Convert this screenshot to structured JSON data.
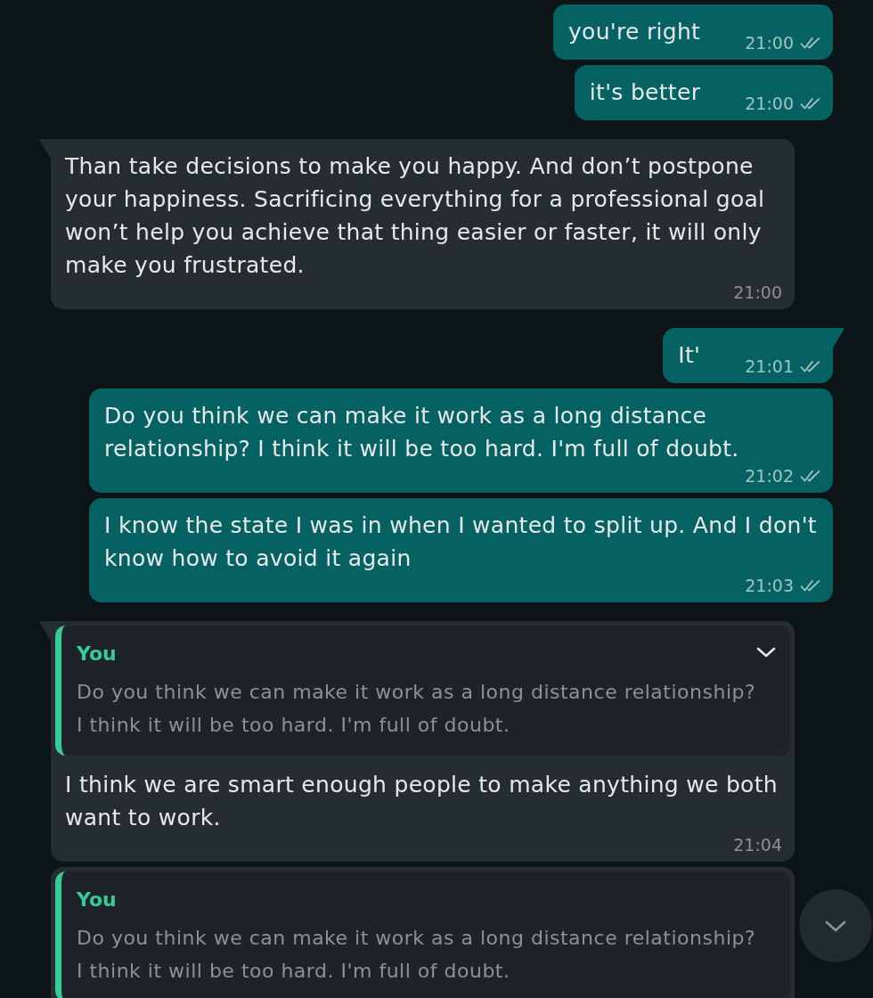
{
  "messages": [
    {
      "kind": "outgoing",
      "tail": false,
      "text": "you're right",
      "time": "21:00",
      "delivered": true,
      "read": false
    },
    {
      "kind": "outgoing",
      "tail": false,
      "text": "it's better",
      "time": "21:00",
      "delivered": true,
      "read": false
    },
    {
      "kind": "incoming",
      "tail": true,
      "text": "Than take decisions to make you happy. And don’t postpone your happiness. Sacrificing everything for a professional goal won’t help you achieve that thing easier or faster, it will only make you frustrated.",
      "time": "21:00"
    },
    {
      "kind": "outgoing",
      "tail": true,
      "text": "It'",
      "time": "21:01",
      "delivered": true,
      "read": false
    },
    {
      "kind": "outgoing",
      "tail": false,
      "text": "Do you think we can make it work as a long distance relationship? I think it will be too hard. I'm full of doubt.",
      "time": "21:02",
      "delivered": true,
      "read": false
    },
    {
      "kind": "outgoing",
      "tail": false,
      "text": "I know the state I was in when I wanted to split up. And I don't know how to avoid it again",
      "time": "21:03",
      "delivered": true,
      "read": false
    },
    {
      "kind": "incoming",
      "tail": true,
      "quote": {
        "author": "You",
        "text": "Do you think we can make it work as a long distance relationship? I think it will be too hard. I'm full of doubt."
      },
      "menu_chevron": true,
      "text": "I think we are smart enough people to make anything we both want to work.",
      "time": "21:04"
    },
    {
      "kind": "incoming",
      "tail": false,
      "quote": {
        "author": "You",
        "text": "Do you think we can make it work as a long distance relationship? I think it will be too hard. I'm full of doubt."
      },
      "menu_chevron": false
    }
  ],
  "scroll_to_bottom": {
    "shown": true
  }
}
